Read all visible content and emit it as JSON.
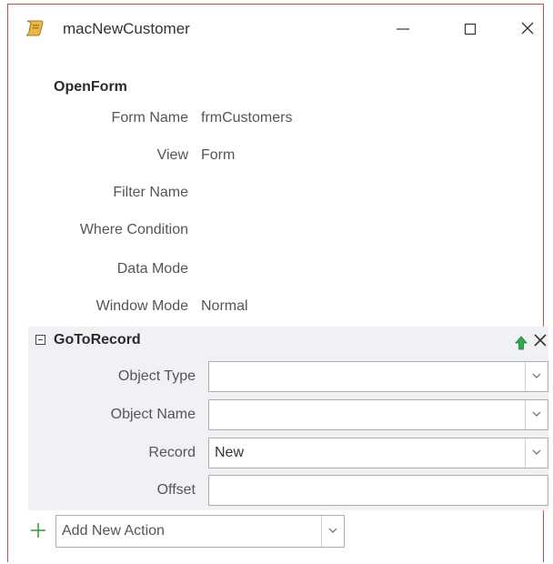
{
  "window": {
    "title": "macNewCustomer"
  },
  "open_form": {
    "title": "OpenForm",
    "rows": [
      {
        "label": "Form Name",
        "value": "frmCustomers"
      },
      {
        "label": "View",
        "value": "Form"
      },
      {
        "label": "Filter Name",
        "value": ""
      },
      {
        "label": "Where Condition",
        "value": ""
      },
      {
        "label": "Data Mode",
        "value": ""
      },
      {
        "label": "Window Mode",
        "value": "Normal"
      }
    ]
  },
  "goto_record": {
    "title": "GoToRecord",
    "fields": [
      {
        "label": "Object Type",
        "value": "",
        "dropdown": true
      },
      {
        "label": "Object Name",
        "value": "",
        "dropdown": true
      },
      {
        "label": "Record",
        "value": "New",
        "dropdown": true
      },
      {
        "label": "Offset",
        "value": "",
        "dropdown": false
      }
    ]
  },
  "add_action": {
    "label": "Add New Action"
  },
  "colors": {
    "accent_border": "#c9504a",
    "action_bg": "#eff1f4",
    "add_green": "#3aa040",
    "arrow_green": "#33a853"
  },
  "icons": [
    "macro-scroll-icon",
    "minimize-icon",
    "maximize-icon",
    "close-icon",
    "collapse-toggle-icon",
    "move-up-icon",
    "delete-action-icon",
    "chevron-down-icon",
    "plus-icon"
  ]
}
